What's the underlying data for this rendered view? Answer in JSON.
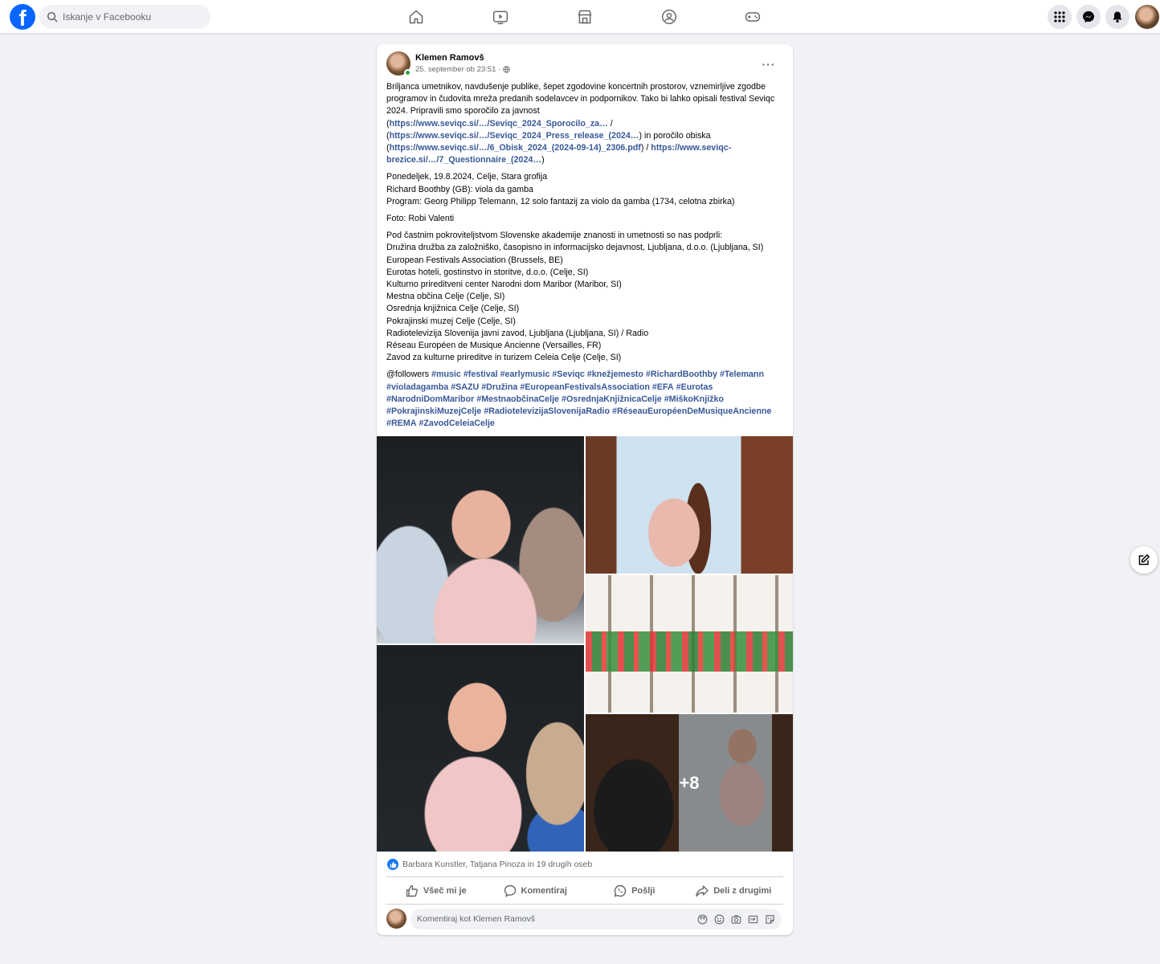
{
  "header": {
    "logo_letter": "f",
    "search_placeholder": "Iskanje v Facebooku",
    "nav": [
      "home-icon",
      "video-icon",
      "marketplace-icon",
      "groups-icon",
      "gaming-icon"
    ],
    "right_buttons": [
      "menu-grid-icon",
      "messenger-icon",
      "bell-icon"
    ]
  },
  "post": {
    "author": "Klemen Ramovš",
    "time": "25. september ob 23:51 ·",
    "more": "···",
    "paragraphs": {
      "p1_text": "Briljanca umetnikov, navdušenje publike, šepet zgodovine koncertnih prostorov, vznemirljive zgodbe programov in čudovita mreža predanih sodelavcev in podpornikov. Tako bi lahko opisali festival Seviqc 2024. Pripravili smo sporočilo za javnost",
      "link1": "https://www.seviqc.si/…/Seviqc_2024_Sporocilo_za…",
      "sep1": " / ",
      "link2": "https://www.seviqc.si/…/Seviqc_2024_Press_release_(2024…",
      "mid": ") in poročilo obiska",
      "link3": "https://www.seviqc.si/…/6_Obisk_2024_(2024-09-14)_2306.pdf",
      "sep2": ") / ",
      "link4": "https://www.seviqc-brezice.si/…/7_Questionnaire_(2024…",
      "end": ")",
      "concert_lines": [
        "Ponedeljek, 19.8.2024, Celje, Stara grofija",
        "Richard Boothby (GB): viola da gamba",
        "Program: Georg Philipp Telemann, 12 solo fantazij za violo da gamba (1734, celotna zbirka)"
      ],
      "photo_credit": "Foto: Robi Valenti",
      "sponsors": [
        "Pod častnim pokroviteljstvom Slovenske akademije znanosti in umetnosti so nas podprli:",
        "Družina družba za založniško, časopisno in informacijsko dejavnost, Ljubljana, d.o.o. (Ljubljana, SI)",
        "European Festivals Association (Brussels, BE)",
        "Eurotas hoteli, gostinstvo in storitve, d.o.o. (Celje, SI)",
        "Kulturno prireditveni center Narodni dom Maribor (Maribor, SI)",
        "Mestna občina Celje (Celje, SI)",
        "Osrednja knjižnica Celje (Celje, SI)",
        "Pokrajinski muzej Celje (Celje, SI)",
        "Radiotelevizija Slovenija javni zavod, Ljubljana (Ljubljana, SI) / Radio",
        "Réseau Européen de Musique Ancienne (Versailles, FR)",
        "Zavod za kulturne prireditve in turizem Celeia Celje (Celje, SI)"
      ],
      "followers": "@followers",
      "hashtags": [
        "#music",
        "#festival",
        "#earlymusic",
        "#Seviqc",
        "#knežjemesto",
        "#RichardBoothby",
        "#Telemann",
        "#violadagamba",
        "#SAZU",
        "#Družina",
        "#EuropeanFestivalsAssociation",
        "#EFA",
        "#Eurotas",
        "#NarodniDomMaribor",
        "#MestnaobčinaCelje",
        "#OsrednjaKnjižnicaCelje",
        "#MiškoKnjižko",
        "#PokrajinskiMuzejCelje",
        "#RadiotelevizijaSlovenijaRadio",
        "#RéseauEuropéenDeMusiqueAncienne",
        "#REMA",
        "#ZavodCeleiaCelje"
      ]
    },
    "more_photos": "+8",
    "reactions_text": "Barbara Kunstler, Tatjana Pinoza in 19 drugih oseb",
    "actions": {
      "like": "Všeč mi je",
      "comment": "Komentiraj",
      "send": "Pošlji",
      "share": "Deli z drugimi"
    },
    "comment_placeholder": "Komentiraj kot Klemen Ramovš"
  }
}
